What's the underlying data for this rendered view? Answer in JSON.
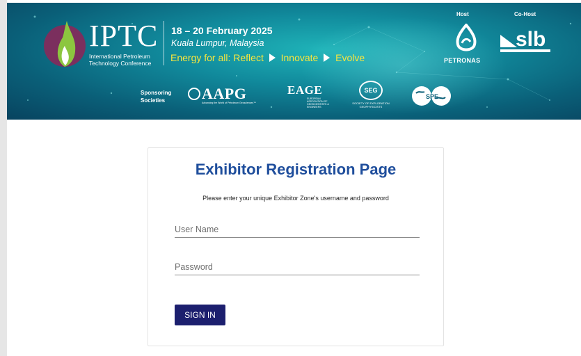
{
  "banner": {
    "logo_text": "IPTC",
    "logo_subtitle": "International Petroleum\nTechnology Conference",
    "event_date": "18 – 20 February 2025",
    "event_location": "Kuala Lumpur, Malaysia",
    "tagline": {
      "part1": "Energy for all: Reflect",
      "part2": "Innovate",
      "part3": "Evolve"
    },
    "host_label": "Host",
    "cohost_label": "Co-Host",
    "host_name": "PETRONAS",
    "cohost_name": "slb",
    "sponsoring_label": "Sponsoring\nSocieties",
    "sponsors": [
      {
        "name": "AAPG",
        "tagline": "Advancing the World of Petroleum Geosciences™"
      },
      {
        "name": "EAGE",
        "tagline": "EUROPEAN ASSOCIATION OF GEOSCIENTISTS & ENGINEERS"
      },
      {
        "name": "SEG",
        "tagline": "SOCIETY OF EXPLORATION GEOPHYSICISTS"
      },
      {
        "name": "SPE"
      }
    ],
    "colors": {
      "tagline": "#f7e63e",
      "banner_dark": "#08435f",
      "banner_light": "#1fb3b8"
    }
  },
  "form": {
    "title": "Exhibitor Registration Page",
    "subtitle": "Please enter your unique Exhibitor Zone's username and password",
    "username": {
      "placeholder": "User Name",
      "value": ""
    },
    "password": {
      "placeholder": "Password",
      "value": ""
    },
    "submit_label": "SIGN IN",
    "colors": {
      "title": "#1f4e9c",
      "button": "#1c1f6e"
    }
  }
}
